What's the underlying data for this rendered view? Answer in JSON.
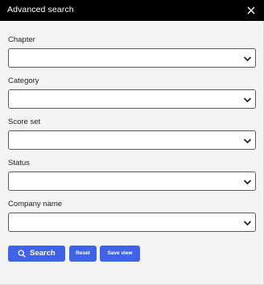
{
  "dialog": {
    "title": "Advanced search",
    "close_icon": "close-icon"
  },
  "fields": [
    {
      "label": "Chapter",
      "value": ""
    },
    {
      "label": "Category",
      "value": ""
    },
    {
      "label": "Score set",
      "value": ""
    },
    {
      "label": "Status",
      "value": ""
    },
    {
      "label": "Company name",
      "value": ""
    }
  ],
  "actions": {
    "search_label": "Search",
    "search_icon": "search-icon",
    "reset_label": "Reset",
    "save_view_label": "Save view"
  },
  "colors": {
    "header_bg": "#000000",
    "panel_bg": "#f4f4f4",
    "button_bg": "#3f63e8"
  }
}
